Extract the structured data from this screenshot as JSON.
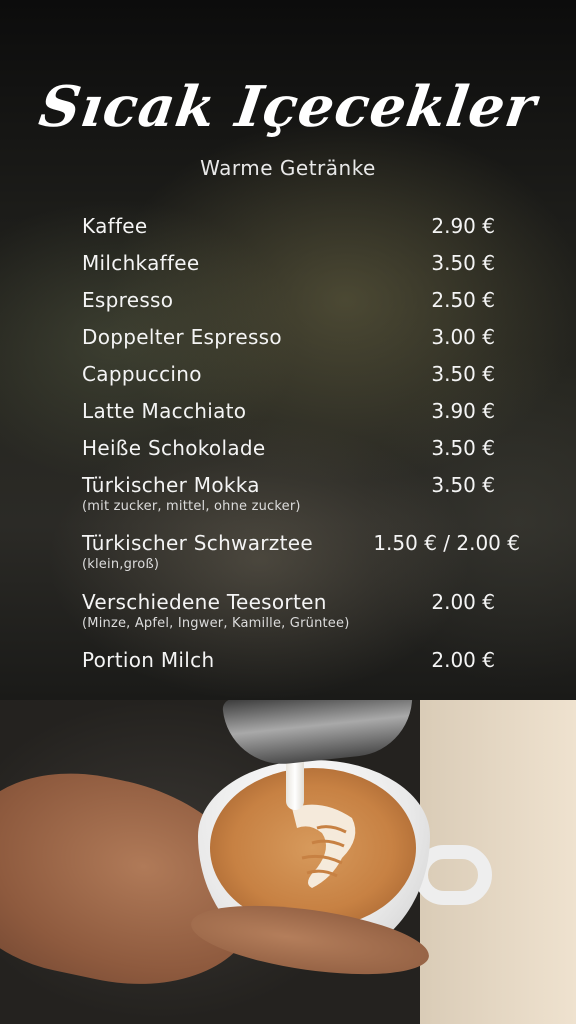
{
  "header": {
    "title": "Sıcak Içecekler",
    "subtitle": "Warme Getränke"
  },
  "menu": {
    "items": [
      {
        "name": "Kaffee",
        "price": "2.90 €",
        "note": ""
      },
      {
        "name": "Milchkaffee",
        "price": "3.50 €",
        "note": ""
      },
      {
        "name": "Espresso",
        "price": "2.50 €",
        "note": ""
      },
      {
        "name": "Doppelter Espresso",
        "price": "3.00 €",
        "note": ""
      },
      {
        "name": "Cappuccino",
        "price": "3.50 €",
        "note": ""
      },
      {
        "name": "Latte Macchiato",
        "price": "3.90 €",
        "note": ""
      },
      {
        "name": "Heiße Schokolade",
        "price": "3.50 €",
        "note": ""
      },
      {
        "name": "Türkischer Mokka",
        "price": "3.50 €",
        "note": "(mit zucker, mittel, ohne zucker)"
      },
      {
        "name": "Türkischer Schwarztee",
        "price": "1.50 € / 2.00 €",
        "note": "(klein,groß)"
      },
      {
        "name": "Verschiedene Teesorten",
        "price": "2.00 €",
        "note": "(Minze, Apfel, Ingwer, Kamille, Grüntee)"
      },
      {
        "name": "Portion Milch",
        "price": "2.00 €",
        "note": ""
      }
    ]
  },
  "colors": {
    "text": "#f4f4f4",
    "background": "#1c1c19",
    "coffee": "#c78143"
  },
  "photo": {
    "subject": "latte-art-pour-icon"
  }
}
